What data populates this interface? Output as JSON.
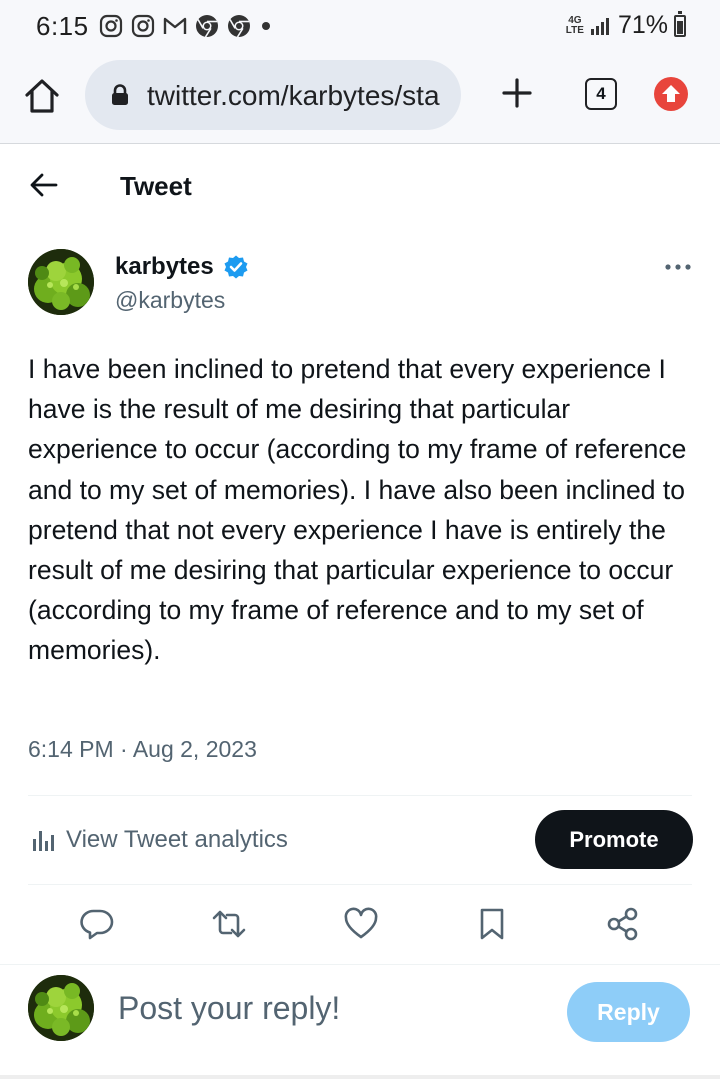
{
  "status_bar": {
    "time": "6:15",
    "notification_icons": [
      "instagram-icon",
      "instagram-icon",
      "gmail-icon",
      "chrome-icon",
      "chrome-icon"
    ],
    "network": "4G LTE",
    "network_top": "4G",
    "network_bottom": "LTE",
    "battery_percent": "71%"
  },
  "browser": {
    "url": "twitter.com/karbytes/sta",
    "tab_count": "4"
  },
  "header": {
    "title": "Tweet"
  },
  "tweet": {
    "author_name": "karbytes",
    "author_handle": "@karbytes",
    "verified": true,
    "text": "I have been inclined to pretend that every experience I have is the result of me desiring that particular experience to occur (according to my frame of reference and to my set of memories). I have also been inclined to pretend that not every experience I have is entirely the result of me desiring that particular experience to occur (according to my frame of reference and to my set of memories).",
    "timestamp": "6:14 PM · Aug 2, 2023"
  },
  "analytics": {
    "label": "View Tweet analytics",
    "promote_label": "Promote"
  },
  "actions": [
    "reply-icon",
    "retweet-icon",
    "like-icon",
    "bookmark-icon",
    "share-icon"
  ],
  "reply_bar": {
    "placeholder": "Post your reply!",
    "reply_label": "Reply"
  },
  "colors": {
    "text_primary": "#0f1419",
    "text_secondary": "#536471",
    "verified_blue": "#1d9bf0",
    "reply_button_disabled": "#8ecdf8",
    "promote_button": "#0f1419",
    "chrome_update_red": "#e8453c"
  }
}
